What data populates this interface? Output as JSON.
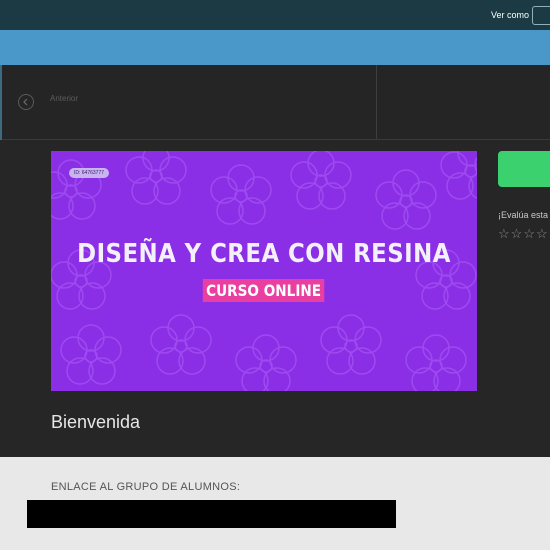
{
  "header": {
    "view_as_label": "Ver como"
  },
  "nav": {
    "previous_label": "Anterior",
    "previous_icon": "chevron-left-icon"
  },
  "banner": {
    "id_badge": "ID: 64763777",
    "title": "DISEÑA Y CREA CON RESINA",
    "subtitle": "CURSO ONLINE",
    "background_color": "#8a2fe6",
    "subtitle_color": "#e83fa0"
  },
  "lesson": {
    "title": "Bienvenida"
  },
  "sidebar": {
    "rate_text": "¡Evalúa esta",
    "stars": [
      "☆",
      "☆",
      "☆",
      "☆"
    ],
    "action_button_color": "#3bd16f"
  },
  "content": {
    "group_link_label": "ENLACE AL GRUPO DE ALUMNOS:"
  },
  "colors": {
    "topbar": "#1b3a44",
    "blueband": "#4a97c9",
    "dark_bg": "#262626",
    "light_bg": "#e8e8e8"
  }
}
